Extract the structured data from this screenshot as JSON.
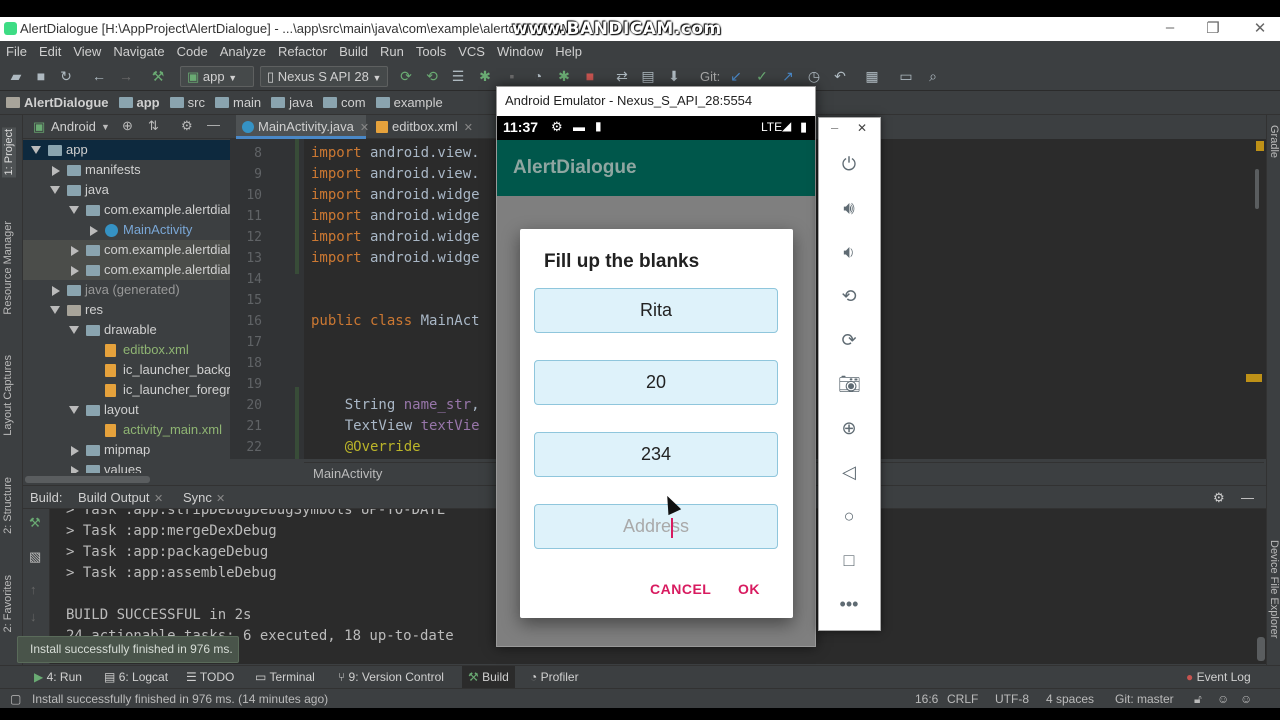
{
  "window": {
    "title": "AlertDialogue [H:\\AppProject\\AlertDialogue] - ...\\app\\src\\main\\java\\com\\example\\alertdialogue\\M",
    "watermark": "www.BANDICAM.com"
  },
  "menu": [
    "File",
    "Edit",
    "View",
    "Navigate",
    "Code",
    "Analyze",
    "Refactor",
    "Build",
    "Run",
    "Tools",
    "VCS",
    "Window",
    "Help"
  ],
  "toolbar": {
    "run_config": "app",
    "device": "Nexus S API 28",
    "git_label": "Git:"
  },
  "breadcrumb": [
    "AlertDialogue",
    "app",
    "src",
    "main",
    "java",
    "com",
    "example"
  ],
  "project_panel": {
    "view": "Android",
    "tree": [
      {
        "label": "app",
        "level": 0,
        "state": "open",
        "icon": "folder-icon",
        "selected": true
      },
      {
        "label": "manifests",
        "level": 1,
        "state": "closed",
        "icon": "folder-icon"
      },
      {
        "label": "java",
        "level": 1,
        "state": "open",
        "icon": "folder-icon"
      },
      {
        "label": "com.example.alertdialogue",
        "level": 2,
        "state": "open",
        "icon": "package-icon"
      },
      {
        "label": "MainActivity",
        "level": 3,
        "state": "closed",
        "icon": "class-icon",
        "link": true
      },
      {
        "label": "com.example.alertdialogue",
        "level": 2,
        "state": "closed",
        "icon": "package-icon",
        "highlight": true
      },
      {
        "label": "com.example.alertdialogue",
        "level": 2,
        "state": "closed",
        "icon": "package-icon",
        "highlight": true
      },
      {
        "label": "java (generated)",
        "level": 1,
        "state": "closed",
        "icon": "folder-icon",
        "muted": true
      },
      {
        "label": "res",
        "level": 1,
        "state": "open",
        "icon": "res-folder-icon"
      },
      {
        "label": "drawable",
        "level": 2,
        "state": "open",
        "icon": "folder-icon"
      },
      {
        "label": "editbox.xml",
        "level": 3,
        "state": "none",
        "icon": "xml-file-icon",
        "green": true
      },
      {
        "label": "ic_launcher_background",
        "level": 3,
        "state": "none",
        "icon": "xml-file-icon"
      },
      {
        "label": "ic_launcher_foreground",
        "level": 3,
        "state": "none",
        "icon": "xml-file-icon"
      },
      {
        "label": "layout",
        "level": 2,
        "state": "open",
        "icon": "folder-icon"
      },
      {
        "label": "activity_main.xml",
        "level": 3,
        "state": "none",
        "icon": "xml-file-icon",
        "green": true
      },
      {
        "label": "mipmap",
        "level": 2,
        "state": "closed",
        "icon": "folder-icon"
      },
      {
        "label": "values",
        "level": 2,
        "state": "closed",
        "icon": "folder-icon"
      }
    ]
  },
  "editor": {
    "tabs": [
      {
        "label": "MainActivity.java",
        "active": true
      },
      {
        "label": "editbox.xml",
        "active": false
      }
    ],
    "lines": [
      {
        "n": "8",
        "text": "import android.view."
      },
      {
        "n": "9",
        "text": "import android.view."
      },
      {
        "n": "10",
        "text": "import android.widge"
      },
      {
        "n": "11",
        "text": "import android.widge"
      },
      {
        "n": "12",
        "text": "import android.widge"
      },
      {
        "n": "13",
        "text": "import android.widge"
      },
      {
        "n": "14",
        "text": ""
      },
      {
        "n": "15",
        "text": ""
      },
      {
        "n": "16",
        "text": "public class MainAct"
      },
      {
        "n": "17",
        "text": ""
      },
      {
        "n": "18",
        "text": ""
      },
      {
        "n": "19",
        "text": ""
      },
      {
        "n": "20",
        "text": "    String name_str,"
      },
      {
        "n": "21",
        "text": "    TextView textVie"
      },
      {
        "n": "22",
        "text": "    @Override"
      }
    ],
    "breadcrumb": "MainActivity"
  },
  "build_panel": {
    "label": "Build:",
    "tabs": [
      "Build Output",
      "Sync"
    ],
    "lines": [
      "> Task :app:stripDebugDebugSymbols UP-TO-DATE",
      "> Task :app:mergeDexDebug",
      "> Task :app:packageDebug",
      "> Task :app:assembleDebug",
      "",
      "BUILD SUCCESSFUL in 2s",
      "24 actionable tasks: 6 executed, 18 up-to-date"
    ]
  },
  "toast": "Install successfully finished in 976 ms.",
  "bottom_tabs": [
    "4: Run",
    "6: Logcat",
    "TODO",
    "Terminal",
    "9: Version Control",
    "Build",
    "Profiler",
    "Event Log"
  ],
  "status_bar": {
    "message": "Install successfully finished in 976 ms. (14 minutes ago)",
    "position": "16:6",
    "line_sep": "CRLF",
    "encoding": "UTF-8",
    "indent": "4 spaces",
    "branch": "Git: master"
  },
  "left_vertical_tabs": [
    "1: Project",
    "Resource Manager",
    "Layout Captures",
    "2: Structure",
    "2: Favorites"
  ],
  "right_vertical_tabs": [
    "Gradle",
    "Device File Explorer"
  ],
  "emulator": {
    "title": "Android Emulator - Nexus_S_API_28:5554",
    "time": "11:37",
    "network": "LTE",
    "app_title": "AlertDialogue",
    "dialog": {
      "title": "Fill up the blanks",
      "fields": [
        {
          "value": "Rita",
          "placeholder": false
        },
        {
          "value": "20",
          "placeholder": false
        },
        {
          "value": "234",
          "placeholder": false
        },
        {
          "value": "Address",
          "placeholder": true
        }
      ],
      "cancel": "CANCEL",
      "ok": "OK"
    }
  },
  "colors": {
    "ide_bg": "#3c3f41",
    "editor_bg": "#2b2b2b",
    "app_bar": "#00574b",
    "accent": "#d81b60",
    "field_bg": "#def2fa"
  }
}
